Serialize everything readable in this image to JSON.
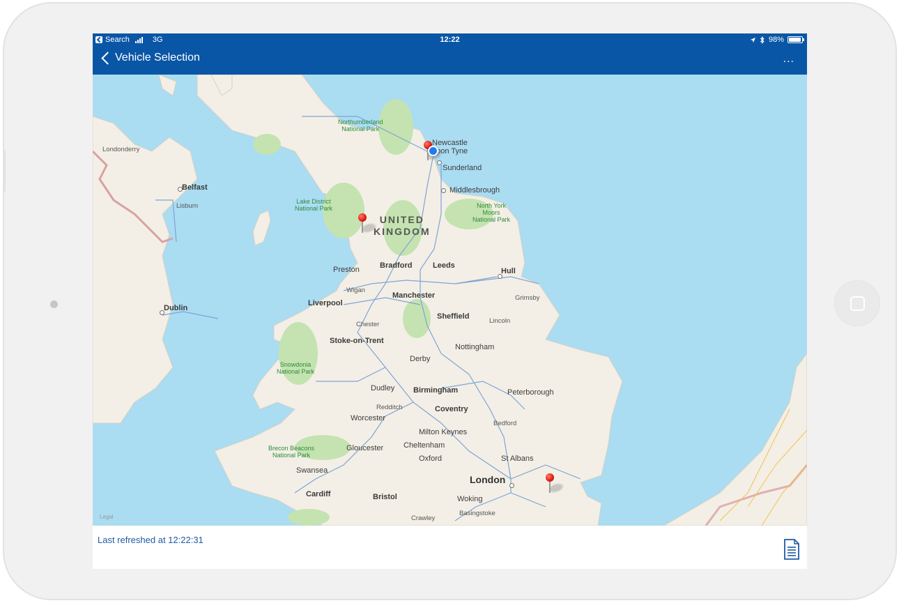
{
  "status_bar": {
    "back_app": "Search",
    "network": "3G",
    "time": "12:22",
    "battery": "98%"
  },
  "nav": {
    "back_label": "Vehicle Selection",
    "more_label": "..."
  },
  "map": {
    "country_label": "UNITED\nKINGDOM",
    "legal": "Legal",
    "cities": {
      "newcastle": "Newcastle\nupon Tyne",
      "sunderland": "Sunderland",
      "middlesbrough": "Middlesbrough",
      "belfast": "Belfast",
      "lisburn": "Lisburn",
      "londonderry": "Londonderry",
      "dublin": "Dublin",
      "preston": "Preston",
      "bradford": "Bradford",
      "leeds": "Leeds",
      "hull": "Hull",
      "grimsby": "Grimsby",
      "wigan": "Wigan",
      "liverpool": "Liverpool",
      "manchester": "Manchester",
      "sheffield": "Sheffield",
      "lincoln": "Lincoln",
      "chester": "Chester",
      "stoke": "Stoke-on-Trent",
      "nottingham": "Nottingham",
      "derby": "Derby",
      "dudley": "Dudley",
      "birmingham": "Birmingham",
      "peterborough": "Peterborough",
      "redditch": "Redditch",
      "coventry": "Coventry",
      "worcester": "Worcester",
      "milton_keynes": "Milton Keynes",
      "bedford": "Bedford",
      "gloucester": "Gloucester",
      "cheltenham": "Cheltenham",
      "oxford": "Oxford",
      "st_albans": "St Albans",
      "swansea": "Swansea",
      "london": "London",
      "cardiff": "Cardiff",
      "bristol": "Bristol",
      "woking": "Woking",
      "basingstoke": "Basingstoke",
      "crawley": "Crawley"
    },
    "parks": {
      "northumberland": "Northumberland\nNational Park",
      "lake_district": "Lake District\nNational Park",
      "north_york": "North York\nMoors\nNational Park",
      "snowdonia": "Snowdonia\nNational Park",
      "brecon": "Brecon Beacons\nNational Park"
    }
  },
  "footer": {
    "last_refreshed": "Last refreshed at 12:22:31",
    "report_icon": "document-icon"
  },
  "colors": {
    "bar": "#0a56a6",
    "water": "#aadcf2",
    "land": "#f3efe6",
    "park": "#c4e3b0",
    "refresh_text": "#1f5aa4"
  }
}
